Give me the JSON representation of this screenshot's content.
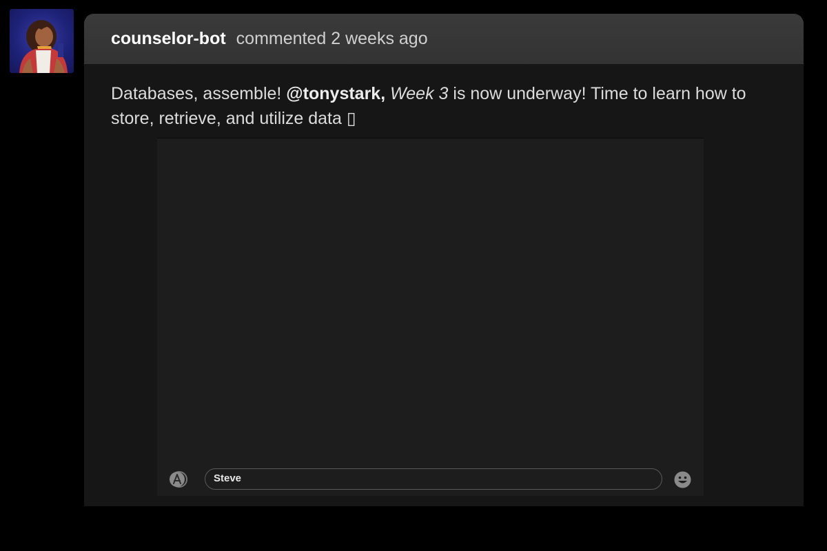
{
  "comment": {
    "author": "counselor-bot",
    "meta": "commented 2 weeks ago",
    "avatar_icon": "counselor-bot-avatar",
    "message": {
      "intro": "Databases, assemble! ",
      "mention": "@tonystark,",
      "week": "Week 3",
      "rest_line1": " is now underway! Time to learn how to",
      "line2": "store, retrieve, and utilize data ▯"
    }
  },
  "media": {
    "apps_icon": "app-store-icon",
    "input_text": "Steve",
    "emoji_icon": "emoji-icon"
  },
  "colors": {
    "page_bg": "#000000",
    "header_bg": "#383838",
    "body_bg": "#161616",
    "media_bg": "#1d1d1d",
    "avatar_bg": "#1f237a"
  }
}
